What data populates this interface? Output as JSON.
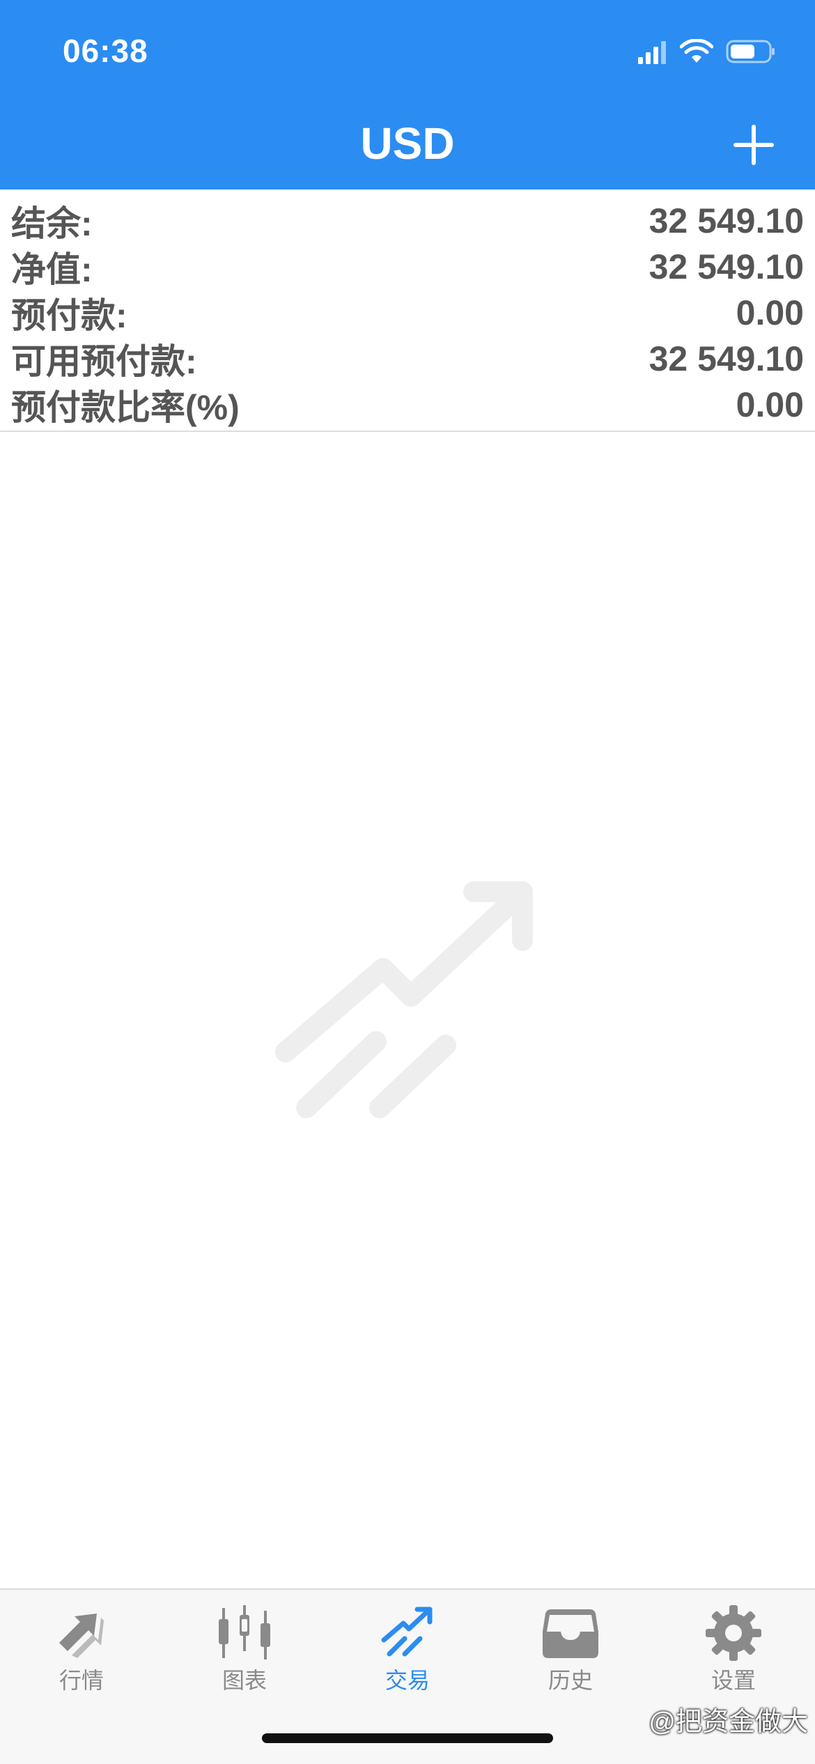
{
  "status_bar": {
    "time": "06:38"
  },
  "header": {
    "title": "USD",
    "add_icon": "plus-icon",
    "background": "#2b8cf2"
  },
  "account_summary": [
    {
      "label": "结余:",
      "value": "32 549.10"
    },
    {
      "label": "净值:",
      "value": "32 549.10"
    },
    {
      "label": "预付款:",
      "value": "0.00"
    },
    {
      "label": "可用预付款:",
      "value": "32 549.10"
    },
    {
      "label": "预付款比率(%)",
      "value": "0.00"
    }
  ],
  "empty_state": {
    "icon": "trade-trend-icon"
  },
  "tabbar": {
    "active_color": "#2b8cf2",
    "items": [
      {
        "label": "行情",
        "icon": "quotes-icon",
        "active": false
      },
      {
        "label": "图表",
        "icon": "chart-candles-icon",
        "active": false
      },
      {
        "label": "交易",
        "icon": "trade-icon",
        "active": true
      },
      {
        "label": "历史",
        "icon": "history-inbox-icon",
        "active": false
      },
      {
        "label": "设置",
        "icon": "gear-icon",
        "active": false
      }
    ]
  },
  "watermark_text": "@把资金做大"
}
